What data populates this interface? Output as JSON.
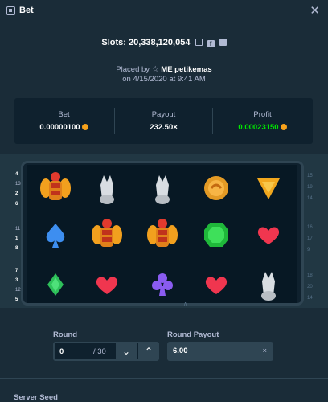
{
  "header": {
    "title": "Bet",
    "close_icon": "close-icon"
  },
  "slots_line": {
    "text": "Slots: 20,338,120,054"
  },
  "placed": {
    "prefix": "Placed by",
    "username": "ME petikemas",
    "date_line": "on 4/15/2020 at 9:41 AM"
  },
  "stats": {
    "bet": {
      "label": "Bet",
      "value": "0.00000100"
    },
    "payout": {
      "label": "Payout",
      "value": "232.50×"
    },
    "profit": {
      "label": "Profit",
      "value": "0.00023150"
    }
  },
  "reels": [
    [
      "scarab",
      "wolf",
      "wolf",
      "coin",
      "triangle"
    ],
    [
      "spade",
      "scarab",
      "scarab",
      "emerald",
      "heart"
    ],
    [
      "diamond",
      "heart",
      "club",
      "heart",
      "wolf"
    ]
  ],
  "left_line_numbers": [
    "4",
    "13",
    "2",
    "6",
    "11",
    "1",
    "8",
    "7",
    "3",
    "12",
    "5"
  ],
  "right_line_numbers": [
    "15",
    "19",
    "14",
    "16",
    "17",
    "9",
    "18",
    "20",
    "14"
  ],
  "colors": {
    "background": "#1a2c38",
    "panel": "#0f212e",
    "profit": "#00e701",
    "coin": "#f7a21b"
  },
  "round": {
    "label": "Round",
    "value": "0",
    "total": "/ 30"
  },
  "round_payout": {
    "label": "Round Payout",
    "value": "6.00"
  },
  "server_seed": {
    "label": "Server Seed"
  }
}
